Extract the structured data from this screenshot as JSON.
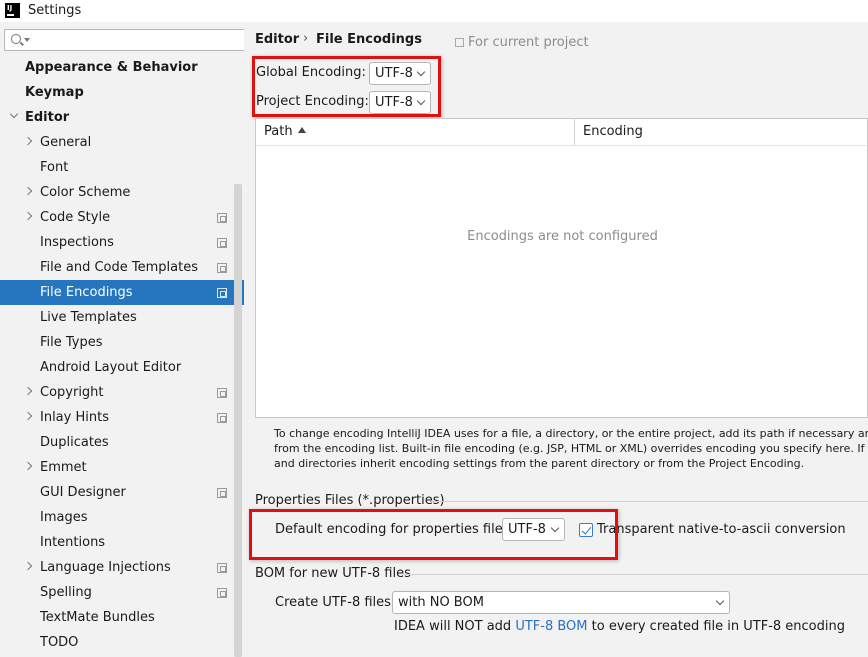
{
  "window": {
    "title": "Settings",
    "app_icon": "IJ"
  },
  "sidebar": {
    "search_placeholder": "",
    "items": [
      {
        "label": "Appearance & Behavior",
        "bold": true
      },
      {
        "label": "Keymap",
        "bold": true
      },
      {
        "label": "Editor",
        "bold": true,
        "expanded": true
      },
      {
        "label": "General",
        "arrow": true
      },
      {
        "label": "Font"
      },
      {
        "label": "Color Scheme",
        "arrow": true
      },
      {
        "label": "Code Style",
        "arrow": true,
        "copy_icon": true
      },
      {
        "label": "Inspections",
        "copy_icon": true
      },
      {
        "label": "File and Code Templates",
        "copy_icon": true
      },
      {
        "label": "File Encodings",
        "copy_icon": true,
        "selected": true
      },
      {
        "label": "Live Templates"
      },
      {
        "label": "File Types"
      },
      {
        "label": "Android Layout Editor"
      },
      {
        "label": "Copyright",
        "arrow": true,
        "copy_icon": true
      },
      {
        "label": "Inlay Hints",
        "arrow": true,
        "copy_icon": true
      },
      {
        "label": "Duplicates"
      },
      {
        "label": "Emmet",
        "arrow": true
      },
      {
        "label": "GUI Designer",
        "copy_icon": true
      },
      {
        "label": "Images"
      },
      {
        "label": "Intentions"
      },
      {
        "label": "Language Injections",
        "arrow": true,
        "copy_icon": true
      },
      {
        "label": "Spelling",
        "copy_icon": true
      },
      {
        "label": "TextMate Bundles"
      },
      {
        "label": "TODO"
      }
    ]
  },
  "breadcrumb": {
    "parent": "Editor",
    "separator": "›",
    "current": "File Encodings"
  },
  "scope_note": "For current project",
  "global_encoding": {
    "label": "Global Encoding:",
    "value": "UTF-8"
  },
  "project_encoding": {
    "label": "Project Encoding:",
    "value": "UTF-8"
  },
  "table": {
    "col_path": "Path",
    "col_encoding": "Encoding",
    "empty_text": "Encodings are not configured"
  },
  "description": {
    "line1": "To change encoding IntelliJ IDEA uses for a file, a directory, or the entire project, add its path if necessary and ther",
    "line2": "from the encoding list. Built-in file encoding (e.g. JSP, HTML or XML) overrides encoding you specify here. If not",
    "line3": "and directories inherit encoding settings from the parent directory or from the Project Encoding."
  },
  "properties_files": {
    "section_title": "Properties Files (*.properties)",
    "default_label": "Default encoding for properties files:",
    "default_value": "UTF-8",
    "transparent_label": "Transparent native-to-ascii conversion",
    "transparent_checked": true
  },
  "bom": {
    "section_title": "BOM for new UTF-8 files",
    "create_label": "Create UTF-8 files:",
    "create_value": "with NO BOM",
    "note_prefix": "IDEA will NOT add",
    "note_link": "UTF-8 BOM",
    "note_suffix": "to every created file in UTF-8 encoding"
  },
  "colors": {
    "selection": "#2675bf",
    "highlight_box": "#e01010",
    "link": "#2a6fc4"
  }
}
